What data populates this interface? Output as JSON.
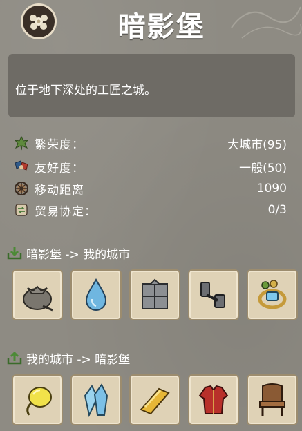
{
  "header": {
    "title": "暗影堡"
  },
  "description": "位于地下深处的工匠之城。",
  "stats": [
    {
      "label": "繁荣度：",
      "value": "大城市(95)",
      "icon": "leaf-icon"
    },
    {
      "label": "友好度：",
      "value": "一般(50)",
      "icon": "handshake-icon"
    },
    {
      "label": "移动距离",
      "value": "1090",
      "icon": "wheel-icon"
    },
    {
      "label": "贸易协定：",
      "value": "0/3",
      "icon": "trade-icon"
    }
  ],
  "import_section": {
    "label": "暗影堡 -> 我的城市",
    "items": [
      "sack-icon",
      "water-drop-icon",
      "iron-crate-icon",
      "dumbbell-icon",
      "gem-ring-icon"
    ]
  },
  "export_section": {
    "label": "我的城市 -> 暗影堡",
    "items": [
      "yellow-balloon-icon",
      "crystal-icon",
      "gold-bar-icon",
      "red-robe-icon",
      "wooden-chair-icon"
    ]
  },
  "colors": {
    "background": "#8e8b83",
    "panel": "#6e6b65",
    "slot": "#dfd2b6",
    "accent_green": "#5f8a3d"
  }
}
